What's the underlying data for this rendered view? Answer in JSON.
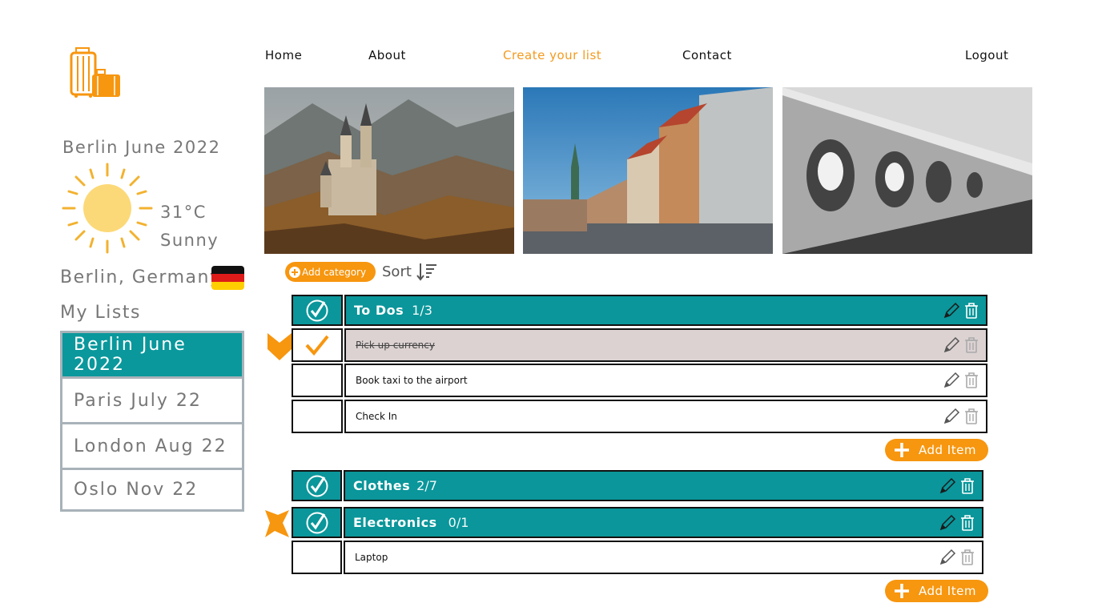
{
  "nav": {
    "home": "Home",
    "about": "About",
    "create": "Create your list",
    "contact": "Contact",
    "logout": "Logout"
  },
  "sidebar": {
    "trip_title": "Berlin June 2022",
    "temperature": "31°C",
    "condition": "Sunny",
    "location": "Berlin, Germany",
    "lists_heading": "My Lists",
    "lists": [
      {
        "label": "Berlin June 2022",
        "active": true
      },
      {
        "label": "Paris July 22",
        "active": false
      },
      {
        "label": "London Aug 22",
        "active": false
      },
      {
        "label": "Oslo Nov 22",
        "active": false
      }
    ]
  },
  "toolbar": {
    "add_category": "Add category",
    "sort": "Sort"
  },
  "categories": [
    {
      "name": "To Dos",
      "count": "1/3",
      "items": [
        {
          "label": "Pick up currency",
          "done": true
        },
        {
          "label": "Book taxi to the airport",
          "done": false
        },
        {
          "label": "Check In",
          "done": false
        }
      ],
      "add_item": "Add Item"
    },
    {
      "name": "Clothes",
      "count": "2/7",
      "items": []
    },
    {
      "name": "Electronics",
      "count": "0/1",
      "items": [
        {
          "label": "Laptop",
          "done": false
        }
      ],
      "add_item": "Add Item"
    }
  ],
  "icons": {
    "logo": "luggage-icon",
    "weather": "sun-icon",
    "flag": "germany-flag-icon",
    "sort": "sort-descending-icon",
    "edit": "pencil-icon",
    "delete": "trash-icon",
    "check": "check-circle-icon",
    "add": "plus-icon",
    "marker": "arrow-marker-icon"
  },
  "colors": {
    "accent": "#f7960f",
    "teal": "#0a969a",
    "done_row": "#dcd2d2",
    "sun": "#fcd978",
    "sun_rays": "#f2b230"
  }
}
